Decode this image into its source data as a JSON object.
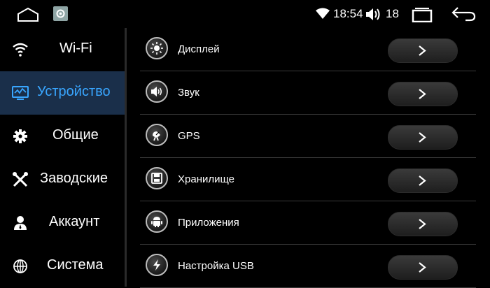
{
  "status_bar": {
    "time": "18:54",
    "volume": "18",
    "icons": [
      "home-icon",
      "app-icon",
      "wifi-icon",
      "volume-icon",
      "recent-apps-icon",
      "back-icon"
    ]
  },
  "sidebar": {
    "items": [
      {
        "label": "Wi-Fi",
        "icon": "wifi-icon",
        "active": false
      },
      {
        "label": "Устройство",
        "icon": "device-icon",
        "active": true
      },
      {
        "label": "Общие",
        "icon": "gear-icon",
        "active": false
      },
      {
        "label": "Заводские",
        "icon": "tools-icon",
        "active": false
      },
      {
        "label": "Аккаунт",
        "icon": "account-icon",
        "active": false
      },
      {
        "label": "Система",
        "icon": "globe-icon",
        "active": false
      }
    ]
  },
  "main": {
    "rows": [
      {
        "label": "Дисплей",
        "icon": "display-icon"
      },
      {
        "label": "Звук",
        "icon": "sound-icon"
      },
      {
        "label": "GPS",
        "icon": "gps-icon"
      },
      {
        "label": "Хранилище",
        "icon": "storage-icon"
      },
      {
        "label": "Приложения",
        "icon": "android-icon"
      },
      {
        "label": "Настройка USB",
        "icon": "usb-icon"
      }
    ]
  },
  "colors": {
    "background": "#000000",
    "active_bg": "#1a2f4a",
    "active_text": "#39a6ff",
    "divider": "#3a3a3a"
  }
}
